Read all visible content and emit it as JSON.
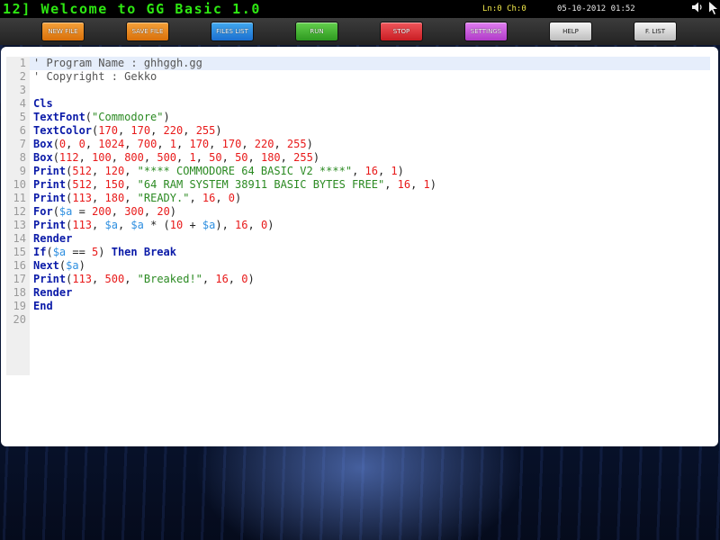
{
  "titlebar": {
    "title": "12] Welcome to GG Basic 1.0",
    "cursor_position": "Ln:0 Ch:0",
    "datetime": "05-10-2012 01:52",
    "speaker_icon": "speaker-icon",
    "arrow_icon": "arrow-icon"
  },
  "toolbar": {
    "buttons": [
      {
        "label": "NEW FILE",
        "color": "#e8860f"
      },
      {
        "label": "SAVE FILE",
        "color": "#e8860f"
      },
      {
        "label": "FILES LIST",
        "color": "#2b8ae8"
      },
      {
        "label": "RUN",
        "color": "#43b52f"
      },
      {
        "label": "STOP",
        "color": "#e0282f"
      },
      {
        "label": "SETTINGS",
        "color": "#c44fdc"
      },
      {
        "label": "HELP",
        "color": "#d8d8d8"
      },
      {
        "label": "F. LIST",
        "color": "#d8d8d8"
      }
    ]
  },
  "editor": {
    "line_numbers": [
      "1",
      "2",
      "3",
      "4",
      "5",
      "6",
      "7",
      "8",
      "9",
      "10",
      "11",
      "12",
      "13",
      "14",
      "15",
      "16",
      "17",
      "18",
      "19",
      "20"
    ],
    "lines": [
      [
        {
          "t": "' Program Name : ghhggh.gg",
          "c": "comment"
        }
      ],
      [
        {
          "t": "' Copyright : Gekko",
          "c": "comment"
        }
      ],
      [],
      [
        {
          "t": "Cls",
          "c": "kw"
        }
      ],
      [
        {
          "t": "TextFont",
          "c": "kw"
        },
        {
          "t": "(",
          "c": "plain"
        },
        {
          "t": "\"Commodore\"",
          "c": "str"
        },
        {
          "t": ")",
          "c": "plain"
        }
      ],
      [
        {
          "t": "TextColor",
          "c": "kw"
        },
        {
          "t": "(",
          "c": "plain"
        },
        {
          "t": "170",
          "c": "num"
        },
        {
          "t": ", ",
          "c": "plain"
        },
        {
          "t": "170",
          "c": "num"
        },
        {
          "t": ", ",
          "c": "plain"
        },
        {
          "t": "220",
          "c": "num"
        },
        {
          "t": ", ",
          "c": "plain"
        },
        {
          "t": "255",
          "c": "num"
        },
        {
          "t": ")",
          "c": "plain"
        }
      ],
      [
        {
          "t": "Box",
          "c": "kw"
        },
        {
          "t": "(",
          "c": "plain"
        },
        {
          "t": "0",
          "c": "num"
        },
        {
          "t": ", ",
          "c": "plain"
        },
        {
          "t": "0",
          "c": "num"
        },
        {
          "t": ", ",
          "c": "plain"
        },
        {
          "t": "1024",
          "c": "num"
        },
        {
          "t": ", ",
          "c": "plain"
        },
        {
          "t": "700",
          "c": "num"
        },
        {
          "t": ", ",
          "c": "plain"
        },
        {
          "t": "1",
          "c": "num"
        },
        {
          "t": ", ",
          "c": "plain"
        },
        {
          "t": "170",
          "c": "num"
        },
        {
          "t": ", ",
          "c": "plain"
        },
        {
          "t": "170",
          "c": "num"
        },
        {
          "t": ", ",
          "c": "plain"
        },
        {
          "t": "220",
          "c": "num"
        },
        {
          "t": ", ",
          "c": "plain"
        },
        {
          "t": "255",
          "c": "num"
        },
        {
          "t": ")",
          "c": "plain"
        }
      ],
      [
        {
          "t": "Box",
          "c": "kw"
        },
        {
          "t": "(",
          "c": "plain"
        },
        {
          "t": "112",
          "c": "num"
        },
        {
          "t": ", ",
          "c": "plain"
        },
        {
          "t": "100",
          "c": "num"
        },
        {
          "t": ", ",
          "c": "plain"
        },
        {
          "t": "800",
          "c": "num"
        },
        {
          "t": ", ",
          "c": "plain"
        },
        {
          "t": "500",
          "c": "num"
        },
        {
          "t": ", ",
          "c": "plain"
        },
        {
          "t": "1",
          "c": "num"
        },
        {
          "t": ", ",
          "c": "plain"
        },
        {
          "t": "50",
          "c": "num"
        },
        {
          "t": ", ",
          "c": "plain"
        },
        {
          "t": "50",
          "c": "num"
        },
        {
          "t": ", ",
          "c": "plain"
        },
        {
          "t": "180",
          "c": "num"
        },
        {
          "t": ", ",
          "c": "plain"
        },
        {
          "t": "255",
          "c": "num"
        },
        {
          "t": ")",
          "c": "plain"
        }
      ],
      [
        {
          "t": "Print",
          "c": "kw"
        },
        {
          "t": "(",
          "c": "plain"
        },
        {
          "t": "512",
          "c": "num"
        },
        {
          "t": ", ",
          "c": "plain"
        },
        {
          "t": "120",
          "c": "num"
        },
        {
          "t": ", ",
          "c": "plain"
        },
        {
          "t": "\"**** COMMODORE 64 BASIC V2 ****\"",
          "c": "str"
        },
        {
          "t": ", ",
          "c": "plain"
        },
        {
          "t": "16",
          "c": "num"
        },
        {
          "t": ", ",
          "c": "plain"
        },
        {
          "t": "1",
          "c": "num"
        },
        {
          "t": ")",
          "c": "plain"
        }
      ],
      [
        {
          "t": "Print",
          "c": "kw"
        },
        {
          "t": "(",
          "c": "plain"
        },
        {
          "t": "512",
          "c": "num"
        },
        {
          "t": ", ",
          "c": "plain"
        },
        {
          "t": "150",
          "c": "num"
        },
        {
          "t": ", ",
          "c": "plain"
        },
        {
          "t": "\"64 RAM SYSTEM 38911 BASIC BYTES FREE\"",
          "c": "str"
        },
        {
          "t": ", ",
          "c": "plain"
        },
        {
          "t": "16",
          "c": "num"
        },
        {
          "t": ", ",
          "c": "plain"
        },
        {
          "t": "1",
          "c": "num"
        },
        {
          "t": ")",
          "c": "plain"
        }
      ],
      [
        {
          "t": "Print",
          "c": "kw"
        },
        {
          "t": "(",
          "c": "plain"
        },
        {
          "t": "113",
          "c": "num"
        },
        {
          "t": ", ",
          "c": "plain"
        },
        {
          "t": "180",
          "c": "num"
        },
        {
          "t": ", ",
          "c": "plain"
        },
        {
          "t": "\"READY.\"",
          "c": "str"
        },
        {
          "t": ", ",
          "c": "plain"
        },
        {
          "t": "16",
          "c": "num"
        },
        {
          "t": ", ",
          "c": "plain"
        },
        {
          "t": "0",
          "c": "num"
        },
        {
          "t": ")",
          "c": "plain"
        }
      ],
      [
        {
          "t": "For",
          "c": "kw"
        },
        {
          "t": "(",
          "c": "plain"
        },
        {
          "t": "$a",
          "c": "var"
        },
        {
          "t": " = ",
          "c": "plain"
        },
        {
          "t": "200",
          "c": "num"
        },
        {
          "t": ", ",
          "c": "plain"
        },
        {
          "t": "300",
          "c": "num"
        },
        {
          "t": ", ",
          "c": "plain"
        },
        {
          "t": "20",
          "c": "num"
        },
        {
          "t": ")",
          "c": "plain"
        }
      ],
      [
        {
          "t": "Print",
          "c": "kw"
        },
        {
          "t": "(",
          "c": "plain"
        },
        {
          "t": "113",
          "c": "num"
        },
        {
          "t": ", ",
          "c": "plain"
        },
        {
          "t": "$a",
          "c": "var"
        },
        {
          "t": ", ",
          "c": "plain"
        },
        {
          "t": "$a",
          "c": "var"
        },
        {
          "t": " * (",
          "c": "plain"
        },
        {
          "t": "10",
          "c": "num"
        },
        {
          "t": " + ",
          "c": "plain"
        },
        {
          "t": "$a",
          "c": "var"
        },
        {
          "t": "), ",
          "c": "plain"
        },
        {
          "t": "16",
          "c": "num"
        },
        {
          "t": ", ",
          "c": "plain"
        },
        {
          "t": "0",
          "c": "num"
        },
        {
          "t": ")",
          "c": "plain"
        }
      ],
      [
        {
          "t": "Render",
          "c": "kw"
        }
      ],
      [
        {
          "t": "If",
          "c": "kw"
        },
        {
          "t": "(",
          "c": "plain"
        },
        {
          "t": "$a",
          "c": "var"
        },
        {
          "t": " == ",
          "c": "plain"
        },
        {
          "t": "5",
          "c": "num"
        },
        {
          "t": ") ",
          "c": "plain"
        },
        {
          "t": "Then Break",
          "c": "kw"
        }
      ],
      [
        {
          "t": "Next",
          "c": "kw"
        },
        {
          "t": "(",
          "c": "plain"
        },
        {
          "t": "$a",
          "c": "var"
        },
        {
          "t": ")",
          "c": "plain"
        }
      ],
      [
        {
          "t": "Print",
          "c": "kw"
        },
        {
          "t": "(",
          "c": "plain"
        },
        {
          "t": "113",
          "c": "num"
        },
        {
          "t": ", ",
          "c": "plain"
        },
        {
          "t": "500",
          "c": "num"
        },
        {
          "t": ", ",
          "c": "plain"
        },
        {
          "t": "\"Breaked!\"",
          "c": "str"
        },
        {
          "t": ", ",
          "c": "plain"
        },
        {
          "t": "16",
          "c": "num"
        },
        {
          "t": ", ",
          "c": "plain"
        },
        {
          "t": "0",
          "c": "num"
        },
        {
          "t": ")",
          "c": "plain"
        }
      ],
      [
        {
          "t": "Render",
          "c": "kw"
        }
      ],
      [
        {
          "t": "End",
          "c": "kw"
        }
      ],
      []
    ]
  }
}
